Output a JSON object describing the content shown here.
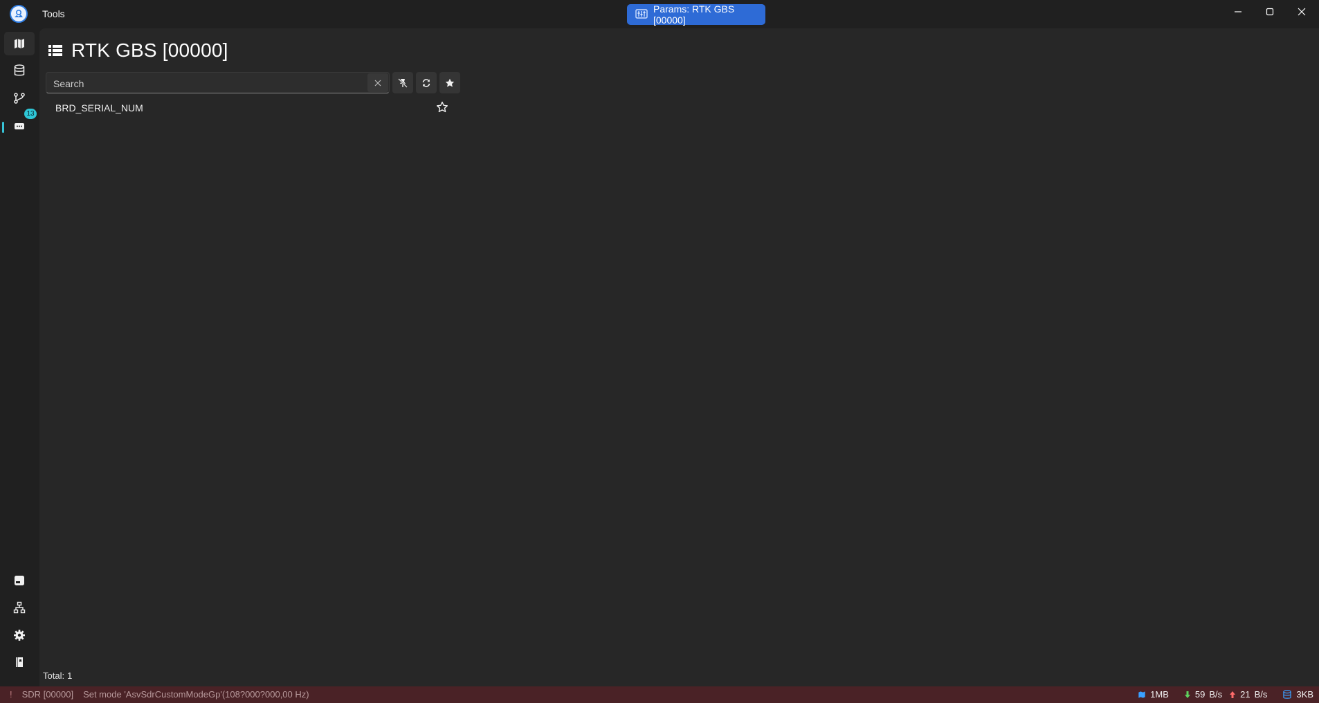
{
  "window": {
    "title": "Tools",
    "active_tab": "Params: RTK GBS [00000]"
  },
  "sidebar": {
    "top_items": [
      {
        "name": "map",
        "icon": "map-icon",
        "active": true
      },
      {
        "name": "database",
        "icon": "database-icon"
      },
      {
        "name": "connections",
        "icon": "graph-icon"
      },
      {
        "name": "devices",
        "icon": "device-icon",
        "badge": "13"
      }
    ],
    "bottom_items": [
      {
        "name": "log",
        "icon": "log-panel-icon"
      },
      {
        "name": "network",
        "icon": "network-icon"
      },
      {
        "name": "settings",
        "icon": "gear-icon"
      },
      {
        "name": "notes",
        "icon": "notebook-icon"
      }
    ]
  },
  "page": {
    "title": "RTK GBS [00000]",
    "search_placeholder": "Search",
    "toolbar": [
      "unpin-icon",
      "refresh-icon",
      "favorites-icon"
    ]
  },
  "params": [
    {
      "name": "BRD_SERIAL_NUM",
      "favorite": false
    }
  ],
  "footer": {
    "total_label": "Total:",
    "total_value": "1"
  },
  "statusbar": {
    "alert_mark": "!",
    "device": "SDR [00000]",
    "message": "Set mode 'AsvSdrCustomModeGp'(108?000?000,00 Hz)",
    "map_cache": "1MB",
    "rx_value": "59",
    "rx_unit": "B/s",
    "tx_value": "21",
    "tx_unit": "B/s",
    "db_size": "3KB"
  },
  "colors": {
    "accent": "#2e6bd6",
    "badge": "#2ec6d6",
    "statusbar_bg": "#4a2226",
    "rx": "#5fd35f",
    "tx": "#ff6b6b",
    "storage": "#3aa0ff"
  }
}
